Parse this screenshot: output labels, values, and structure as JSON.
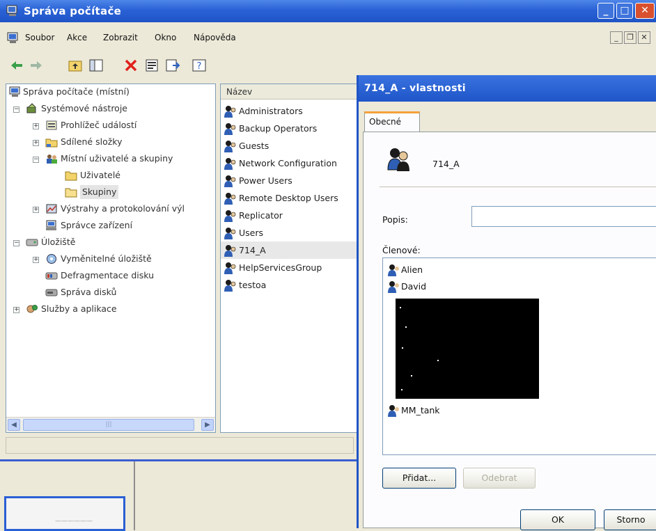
{
  "window": {
    "title": "Správa počítače"
  },
  "menu": {
    "items": [
      "Soubor",
      "Akce",
      "Zobrazit",
      "Okno",
      "Nápověda"
    ]
  },
  "tree": {
    "root": "Správa počítače (místní)",
    "system_tools": "Systémové nástroje",
    "event_viewer": "Prohlížeč událostí",
    "shared_folders": "Sdílené složky",
    "local_users_groups": "Místní uživatelé a skupiny",
    "users": "Uživatelé",
    "groups": "Skupiny",
    "alerts": "Výstrahy a protokolování výl",
    "device_manager": "Správce zařízení",
    "storage": "Úložiště",
    "removable_storage": "Vyměnitelné úložiště",
    "defrag": "Defragmentace disku",
    "disk_mgmt": "Správa disků",
    "services_apps": "Služby a aplikace"
  },
  "list": {
    "column": "Název",
    "rows": [
      "Administrators",
      "Backup Operators",
      "Guests",
      "Network Configuration",
      "Power Users",
      "Remote Desktop Users",
      "Replicator",
      "Users",
      "714_A",
      "HelpServicesGroup",
      "testoa"
    ],
    "selected_index": 8
  },
  "dialog": {
    "title": "714_A - vlastnosti",
    "tab": "Obecné",
    "group_name": "714_A",
    "description_label": "Popis:",
    "description_value": "",
    "members_label": "Členové:",
    "members": [
      "Alien",
      "David",
      "MM_tank"
    ],
    "add_button": "Přidat...",
    "remove_button": "Odebrat",
    "ok_button": "OK",
    "cancel_button": "Storno"
  },
  "taskbar": {
    "thumbnail_text": "——————"
  },
  "colors": {
    "titlebar": "#2a62d6",
    "close": "#d8502e",
    "tab_accent": "#f4a23a",
    "selected_row": "#e8e8e8"
  }
}
